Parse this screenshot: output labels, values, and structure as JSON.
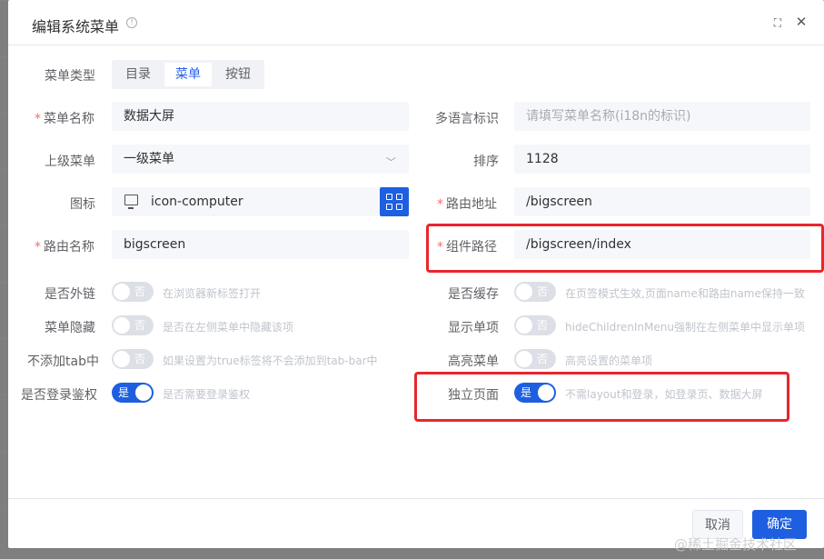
{
  "dialog": {
    "title": "编辑系统菜单"
  },
  "form": {
    "menu_type": {
      "label": "菜单类型",
      "options": [
        "目录",
        "菜单",
        "按钮"
      ],
      "selected": "菜单"
    },
    "menu_name": {
      "label": "菜单名称",
      "value": "数据大屏"
    },
    "i18n": {
      "label": "多语言标识",
      "placeholder": "请填写菜单名称(i18n的标识)"
    },
    "parent_menu": {
      "label": "上级菜单",
      "value": "一级菜单"
    },
    "sort": {
      "label": "排序",
      "value": "1128"
    },
    "icon": {
      "label": "图标",
      "value": "icon-computer"
    },
    "route_path": {
      "label": "路由地址",
      "value": "/bigscreen"
    },
    "route_name": {
      "label": "路由名称",
      "value": "bigscreen"
    },
    "component_path": {
      "label": "组件路径",
      "value": "/bigscreen/index"
    },
    "is_external": {
      "label": "是否外链",
      "state": "否",
      "hint": "在浏览器新标签打开"
    },
    "is_cache": {
      "label": "是否缓存",
      "state": "否",
      "hint": "在页签模式生效,页面name和路由name保持一致"
    },
    "hide_menu": {
      "label": "菜单隐藏",
      "state": "否",
      "hint": "是否在左侧菜单中隐藏该项"
    },
    "show_single": {
      "label": "显示单项",
      "state": "否",
      "hint": "hideChildrenInMenu强制在左侧菜单中显示单项"
    },
    "no_tab": {
      "label": "不添加tab中",
      "state": "否",
      "hint": "如果设置为true标签将不会添加到tab-bar中"
    },
    "highlight": {
      "label": "高亮菜单",
      "state": "否",
      "hint": "高亮设置的菜单项"
    },
    "auth": {
      "label": "是否登录鉴权",
      "state": "是",
      "hint": "是否需要登录鉴权"
    },
    "standalone": {
      "label": "独立页面",
      "state": "是",
      "hint": "不需layout和登录，如登录页、数据大屏"
    }
  },
  "footer": {
    "cancel_label": "取消",
    "ok_label": "确定"
  },
  "watermark": "@稀土掘金技术社区",
  "colors": {
    "primary": "#1d5fe0",
    "highlight_box": "#e8262c",
    "required": "#f56c6c"
  }
}
